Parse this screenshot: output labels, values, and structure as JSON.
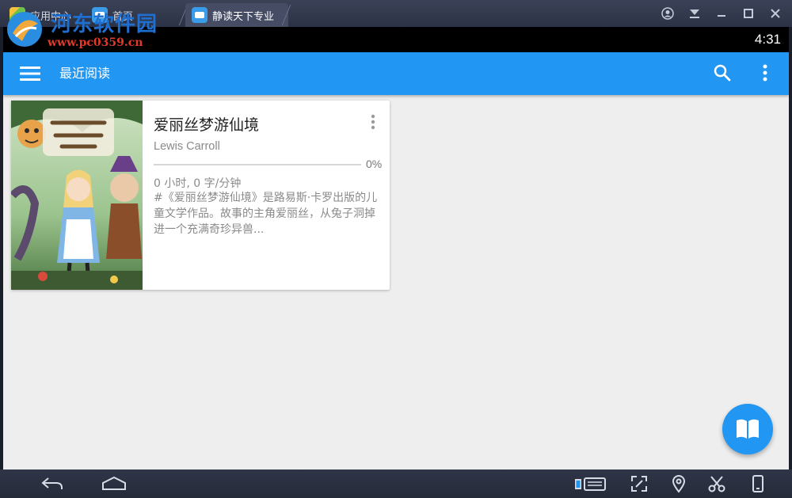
{
  "emulator": {
    "tabs": [
      {
        "label": "应用中心"
      },
      {
        "label": "首页"
      },
      {
        "label": "静读天下专业"
      }
    ],
    "window_controls": [
      "account-icon",
      "download-icon",
      "minimize-icon",
      "maximize-icon",
      "close-icon"
    ],
    "bottom_controls": [
      "back-icon",
      "home-icon",
      "keyboard-icon",
      "fullscreen-icon",
      "location-icon",
      "cut-icon",
      "rotate-icon"
    ]
  },
  "statusbar": {
    "clock": "4:31"
  },
  "appbar": {
    "title": "最近阅读",
    "color": "#2196f3"
  },
  "books": [
    {
      "title": "爱丽丝梦游仙境",
      "author": "Lewis Carroll",
      "progress_percent": 0,
      "progress_label": "0%",
      "reading_time": "0 小时, 0 字/分钟",
      "description": "#《爱丽丝梦游仙境》是路易斯·卡罗出版的儿童文学作品。故事的主角爱丽丝，从兔子洞掉进一个充满奇珍异兽..."
    }
  ],
  "fab": {
    "icon": "open-book-icon"
  },
  "watermark": {
    "title": "河东软件园",
    "url": "www.pc0359.cn"
  }
}
